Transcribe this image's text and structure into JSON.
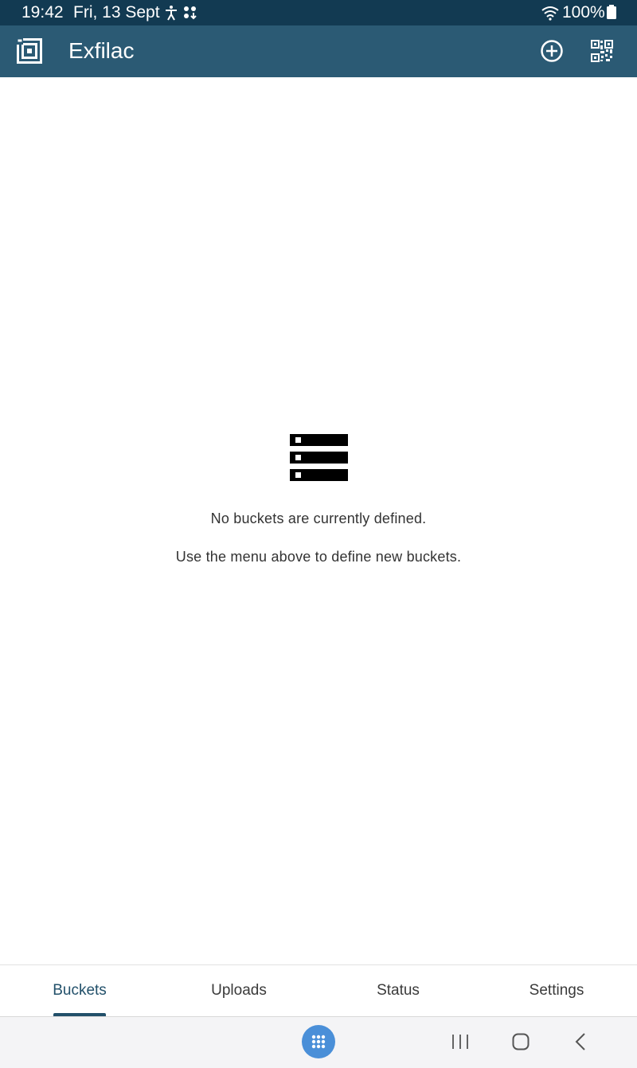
{
  "status_bar": {
    "time": "19:42",
    "date": "Fri, 13 Sept",
    "battery": "100%",
    "icons": [
      "accessibility-icon",
      "dots-download-icon",
      "wifi-icon",
      "battery-icon"
    ]
  },
  "app_bar": {
    "title": "Exfilac",
    "icons": [
      "app-logo-icon",
      "add-circle-icon",
      "qr-code-icon"
    ]
  },
  "empty_state": {
    "icon": "storage-list-icon",
    "message": "No buckets are currently defined.",
    "hint": "Use the menu above to define new buckets."
  },
  "tabs": [
    {
      "label": "Buckets",
      "active": true
    },
    {
      "label": "Uploads",
      "active": false
    },
    {
      "label": "Status",
      "active": false
    },
    {
      "label": "Settings",
      "active": false
    }
  ],
  "nav_bar": {
    "icons": [
      "apps-grid-icon",
      "recents-icon",
      "home-icon",
      "back-icon"
    ]
  },
  "colors": {
    "status_bar_bg": "#123a52",
    "app_bar_bg": "#2b5a74",
    "accent": "#22506a",
    "nav_apps_bg": "#4a8fd8"
  }
}
